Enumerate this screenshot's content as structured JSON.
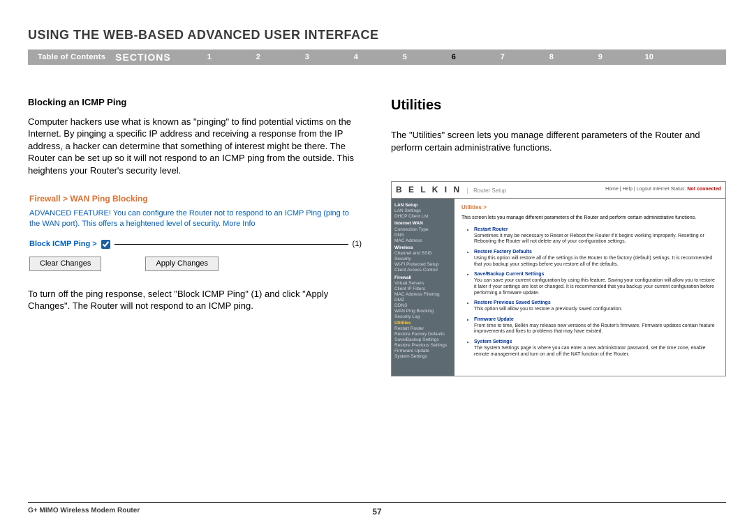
{
  "page": {
    "title": "USING THE WEB-BASED ADVANCED USER INTERFACE",
    "toc_label": "Table of Contents",
    "sections_label": "SECTIONS",
    "sections": [
      "1",
      "2",
      "3",
      "4",
      "5",
      "6",
      "7",
      "8",
      "9",
      "10"
    ],
    "current_section": "6",
    "footer_model": "G+ MIMO Wireless Modem Router",
    "page_number": "57"
  },
  "left": {
    "heading": "Blocking an ICMP Ping",
    "para1": "Computer hackers use what is known as \"pinging\" to find potential victims on the Internet. By pinging a specific IP address and receiving a response from the IP address, a hacker can determine that something of interest might be there. The Router can be set up so it will not respond to an ICMP ping from the outside. This heightens your Router's security level.",
    "fw_title": "Firewall > WAN Ping Blocking",
    "fw_desc": "ADVANCED FEATURE! You can configure the Router not to respond to an ICMP Ping (ping to the WAN port). This offers a heightened level of security. More Info",
    "fw_label": "Block ICMP Ping >",
    "fw_annot": "(1)",
    "btn_clear": "Clear Changes",
    "btn_apply": "Apply Changes",
    "para2": "To turn off the ping response, select \"Block ICMP Ping\" (1) and click \"Apply Changes\". The Router will not respond to an ICMP ping."
  },
  "right": {
    "heading": "Utilities",
    "para1": "The \"Utilities\" screen lets you manage different parameters of the Router and perform certain administrative functions."
  },
  "belkin": {
    "logo": "B E L K I N",
    "setup": "Router Setup",
    "links": "Home | Help | Logout   Internet Status:",
    "status": "Not connected",
    "breadcrumb": "Utilities >",
    "intro": "This screen lets you manage different parameters of the Router and perform certain administrative functions.",
    "sidebar": [
      {
        "type": "hd",
        "label": "LAN Setup"
      },
      {
        "type": "it",
        "label": "LAN Settings"
      },
      {
        "type": "it",
        "label": "DHCP Client List"
      },
      {
        "type": "hd",
        "label": "Internet WAN"
      },
      {
        "type": "it",
        "label": "Connection Type"
      },
      {
        "type": "it",
        "label": "DNS"
      },
      {
        "type": "it",
        "label": "MAC Address"
      },
      {
        "type": "hd",
        "label": "Wireless"
      },
      {
        "type": "it",
        "label": "Channel and SSID"
      },
      {
        "type": "it",
        "label": "Security"
      },
      {
        "type": "it",
        "label": "Wi-Fi Protected Setup"
      },
      {
        "type": "it",
        "label": "Client Access Control"
      },
      {
        "type": "hd",
        "label": "Firewall"
      },
      {
        "type": "it",
        "label": "Virtual Servers"
      },
      {
        "type": "it",
        "label": "Client IP Filters"
      },
      {
        "type": "it",
        "label": "MAC Address Filtering"
      },
      {
        "type": "it",
        "label": "DMZ"
      },
      {
        "type": "it",
        "label": "DDNS"
      },
      {
        "type": "it",
        "label": "WAN Ping Blocking"
      },
      {
        "type": "it",
        "label": "Security Log"
      },
      {
        "type": "sel",
        "label": "Utilities"
      },
      {
        "type": "it",
        "label": "Restart Router"
      },
      {
        "type": "it",
        "label": "Restore Factory Defaults"
      },
      {
        "type": "it",
        "label": "Save/Backup Settings"
      },
      {
        "type": "it",
        "label": "Restore Previous Settings"
      },
      {
        "type": "it",
        "label": "Firmware Update"
      },
      {
        "type": "it",
        "label": "System Settings"
      }
    ],
    "items": [
      {
        "t": "Restart Router",
        "d": "Sometimes it may be necessary to Reset or Reboot the Router if it begins working improperly. Resetting or Rebooting the Router will not delete any of your configuration settings."
      },
      {
        "t": "Restore Factory Defaults",
        "d": "Using this option will restore all of the settings in the Router to the factory (default) settings. It is recommended that you backup your settings before you restore all of the defaults."
      },
      {
        "t": "Save/Backup Current Settings",
        "d": "You can save your current configuration by using this feature. Saving your configuration will allow you to restore it later if your settings are lost or changed. It is recommended that you backup your current configuration before performing a firmware update."
      },
      {
        "t": "Restore Previous Saved Settings",
        "d": "This option will allow you to restore a previously saved configuration."
      },
      {
        "t": "Firmware Update",
        "d": "From time to time, Belkin may release new versions of the Router's firmware. Firmware updates contain feature improvements and fixes to problems that may have existed."
      },
      {
        "t": "System Settings",
        "d": "The System Settings page is where you can enter a new administrator password, set the time zone, enable remote management and turn on and off the NAT function of the Router."
      }
    ]
  }
}
